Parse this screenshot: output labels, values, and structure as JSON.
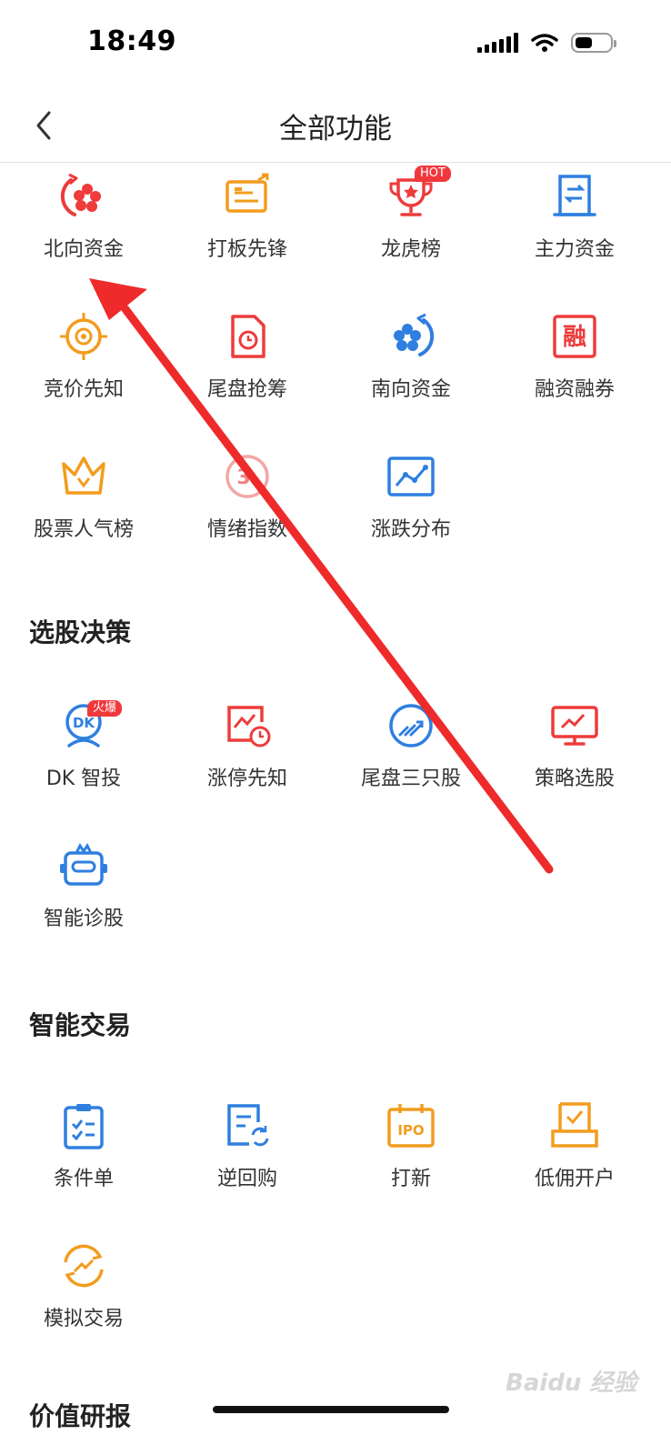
{
  "status_bar": {
    "time": "18:49"
  },
  "header": {
    "title": "全部功能"
  },
  "sections": {
    "s1": {
      "items": [
        {
          "label": "北向资金"
        },
        {
          "label": "打板先锋"
        },
        {
          "label": "龙虎榜",
          "badge": "HOT"
        },
        {
          "label": "主力资金"
        },
        {
          "label": "竞价先知"
        },
        {
          "label": "尾盘抢筹"
        },
        {
          "label": "南向资金"
        },
        {
          "label": "融资融券"
        },
        {
          "label": "股票人气榜"
        },
        {
          "label": "情绪指数"
        },
        {
          "label": "涨跌分布"
        }
      ]
    },
    "s2": {
      "title": "选股决策",
      "items": [
        {
          "label": "DK 智投",
          "badge": "火爆"
        },
        {
          "label": "涨停先知"
        },
        {
          "label": "尾盘三只股"
        },
        {
          "label": "策略选股"
        },
        {
          "label": "智能诊股"
        }
      ]
    },
    "s3": {
      "title": "智能交易",
      "items": [
        {
          "label": "条件单"
        },
        {
          "label": "逆回购"
        },
        {
          "label": "打新"
        },
        {
          "label": "低佣开户"
        },
        {
          "label": "模拟交易"
        }
      ]
    },
    "s4": {
      "title": "价值研报"
    }
  },
  "icon_text": {
    "rong": "融",
    "dk": "DK",
    "ipo": "IPO",
    "emotion": "3"
  },
  "watermark": "Baidu 经验",
  "colors": {
    "red": "#ee3b3b",
    "orange": "#f39c1e",
    "blue": "#2f7fe0",
    "arrow": "#ee2a2a"
  }
}
